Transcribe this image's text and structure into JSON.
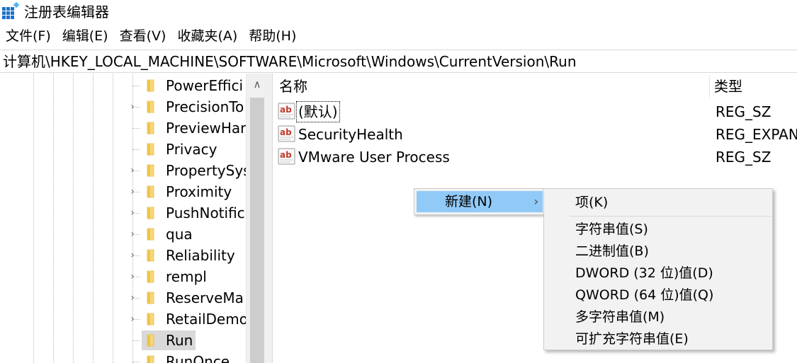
{
  "window": {
    "title": "注册表编辑器",
    "icon": "registry-editor-icon"
  },
  "menubar": [
    "文件(F)",
    "编辑(E)",
    "查看(V)",
    "收藏夹(A)",
    "帮助(H)"
  ],
  "address": "计算机\\HKEY_LOCAL_MACHINE\\SOFTWARE\\Microsoft\\Windows\\CurrentVersion\\Run",
  "tree": {
    "items": [
      {
        "label": "PowerEffici",
        "expandable": false,
        "selected": false
      },
      {
        "label": "PrecisionTo",
        "expandable": true,
        "selected": false
      },
      {
        "label": "PreviewHar",
        "expandable": false,
        "selected": false
      },
      {
        "label": "Privacy",
        "expandable": false,
        "selected": false
      },
      {
        "label": "PropertySys",
        "expandable": true,
        "selected": false
      },
      {
        "label": "Proximity",
        "expandable": true,
        "selected": false
      },
      {
        "label": "PushNotific",
        "expandable": true,
        "selected": false
      },
      {
        "label": "qua",
        "expandable": true,
        "selected": false
      },
      {
        "label": "Reliability",
        "expandable": true,
        "selected": false
      },
      {
        "label": "rempl",
        "expandable": true,
        "selected": false
      },
      {
        "label": "ReserveMa",
        "expandable": true,
        "selected": false
      },
      {
        "label": "RetailDemo",
        "expandable": true,
        "selected": false
      },
      {
        "label": "Run",
        "expandable": false,
        "selected": true
      },
      {
        "label": "RunOnce",
        "expandable": false,
        "selected": false
      }
    ]
  },
  "list": {
    "columns": {
      "name": "名称",
      "type": "类型"
    },
    "rows": [
      {
        "name": "(默认)",
        "type": "REG_SZ",
        "focused": true
      },
      {
        "name": "SecurityHealth",
        "type": "REG_EXPAN",
        "focused": false
      },
      {
        "name": "VMware User Process",
        "type": "REG_SZ",
        "focused": false
      }
    ]
  },
  "context_menu": {
    "new_label": "新建(N)",
    "arrow": "›"
  },
  "submenu": {
    "items": [
      "项(K)",
      "字符串值(S)",
      "二进制值(B)",
      "DWORD (32 位)值(D)",
      "QWORD (64 位)值(Q)",
      "多字符串值(M)",
      "可扩充字符串值(E)"
    ]
  },
  "colors": {
    "menu_highlight": "#91c9f7",
    "selection": "#d9d9d9",
    "folder": "#f8d775"
  }
}
